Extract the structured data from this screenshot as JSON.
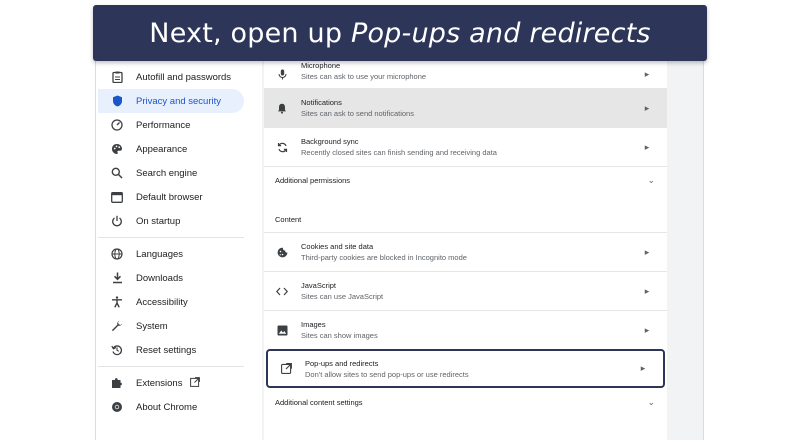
{
  "banner": {
    "prefix": "Next, open up ",
    "emphasis": "Pop-ups and redirects"
  },
  "sidebar": {
    "items": [
      {
        "label": "Autofill and passwords",
        "icon": "clipboard-icon"
      },
      {
        "label": "Privacy and security",
        "icon": "shield-icon",
        "active": true
      },
      {
        "label": "Performance",
        "icon": "speedometer-icon"
      },
      {
        "label": "Appearance",
        "icon": "palette-icon"
      },
      {
        "label": "Search engine",
        "icon": "search-icon"
      },
      {
        "label": "Default browser",
        "icon": "browser-icon"
      },
      {
        "label": "On startup",
        "icon": "power-icon"
      },
      {
        "label": "Languages",
        "icon": "globe-icon"
      },
      {
        "label": "Downloads",
        "icon": "download-icon"
      },
      {
        "label": "Accessibility",
        "icon": "accessibility-icon"
      },
      {
        "label": "System",
        "icon": "wrench-icon"
      },
      {
        "label": "Reset settings",
        "icon": "reset-icon"
      },
      {
        "label": "Extensions",
        "icon": "puzzle-icon"
      },
      {
        "label": "About Chrome",
        "icon": "chrome-icon"
      }
    ]
  },
  "permissions": {
    "rows": [
      {
        "title": "Microphone",
        "subtitle": "Sites can ask to use your microphone",
        "icon": "microphone-icon"
      },
      {
        "title": "Notifications",
        "subtitle": "Sites can ask to send notifications",
        "icon": "bell-icon"
      },
      {
        "title": "Background sync",
        "subtitle": "Recently closed sites can finish sending and receiving data",
        "icon": "sync-icon"
      }
    ],
    "additional_label": "Additional permissions"
  },
  "content": {
    "section_label": "Content",
    "rows": [
      {
        "title": "Cookies and site data",
        "subtitle": "Third-party cookies are blocked in Incognito mode",
        "icon": "cookie-icon"
      },
      {
        "title": "JavaScript",
        "subtitle": "Sites can use JavaScript",
        "icon": "code-icon"
      },
      {
        "title": "Images",
        "subtitle": "Sites can show images",
        "icon": "image-icon"
      },
      {
        "title": "Pop-ups and redirects",
        "subtitle": "Don't allow sites to send pop-ups or use redirects",
        "icon": "popup-icon"
      }
    ],
    "additional_label": "Additional content settings"
  },
  "colors": {
    "banner_bg": "#2d3658",
    "active_nav_bg": "#e8f0fe",
    "active_nav_text": "#1a56c9",
    "highlight_row": "#e6e6e6"
  }
}
